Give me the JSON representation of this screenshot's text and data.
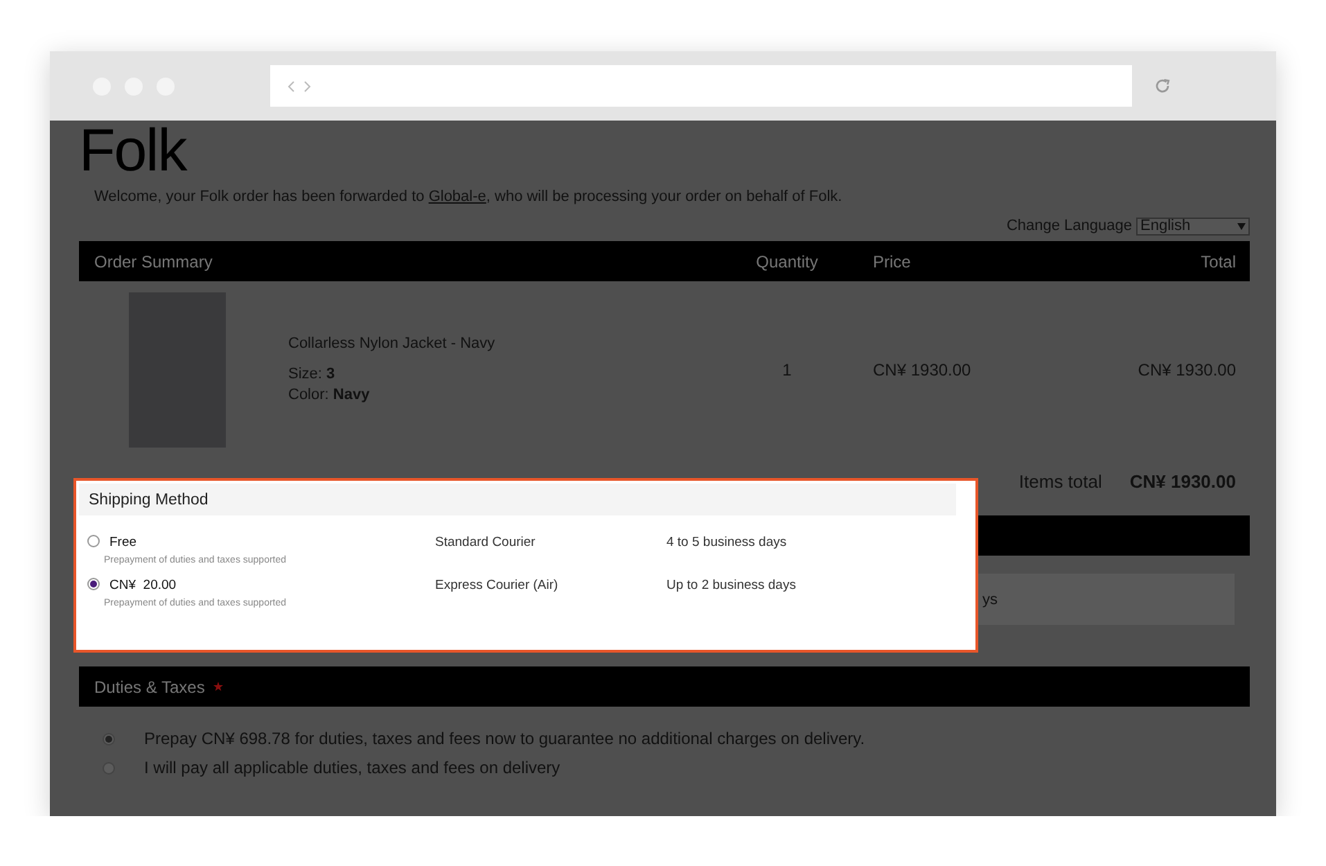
{
  "logo": "Folk",
  "welcome": {
    "before": "Welcome, your Folk order has been forwarded to ",
    "link": "Global-e",
    "after": ", who will be processing your order on behalf of Folk."
  },
  "language": {
    "label": "Change Language",
    "value": "English"
  },
  "order_summary": {
    "columns": [
      "Order Summary",
      "Quantity",
      "Price",
      "Total"
    ],
    "items": [
      {
        "name": "Collarless Nylon Jacket - Navy",
        "size_line": "Size: **3**",
        "color_line": "Color:  **Navy**",
        "quantity": "1",
        "price": "CN¥ 1930.00",
        "total": "CN¥ 1930.00"
      }
    ],
    "items_total_label": "Items total",
    "items_total": "CN¥ 1930.00"
  },
  "covered_fragment": "ys",
  "shipping_method": {
    "title": "Shipping Method",
    "options": [
      {
        "price": "Free",
        "note": "Prepayment of duties and taxes supported",
        "carrier": "Standard Courier",
        "time": "4 to 5 business days",
        "selected": false
      },
      {
        "price": "CN¥  20.00",
        "note": "Prepayment of duties and taxes supported",
        "carrier": "Express Courier (Air)",
        "time": "Up to 2 business days",
        "selected": true
      }
    ]
  },
  "duties": {
    "title": "Duties & Taxes",
    "required": true,
    "options": [
      {
        "label": "Prepay CN¥ 698.78 for duties, taxes and fees now to guarantee no additional charges on delivery.",
        "selected": true
      },
      {
        "label": "I will pay all applicable duties, taxes and fees on delivery",
        "selected": false
      }
    ]
  }
}
